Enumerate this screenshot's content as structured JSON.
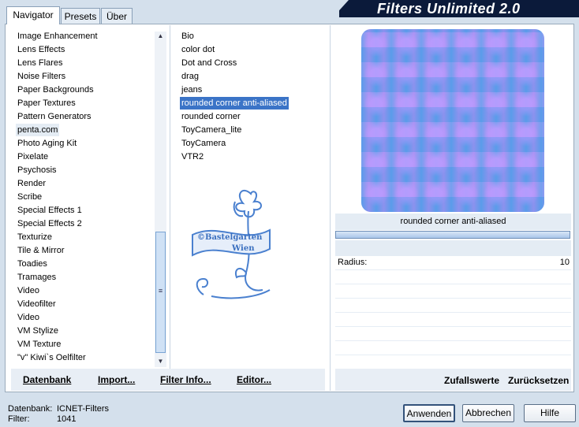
{
  "app": {
    "title": "Filters Unlimited 2.0"
  },
  "tabs": [
    {
      "label": "Navigator",
      "active": true
    },
    {
      "label": "Presets",
      "active": false
    },
    {
      "label": "Über",
      "active": false
    }
  ],
  "categories": [
    "Image Enhancement",
    "Lens Effects",
    "Lens Flares",
    "Noise Filters",
    "Paper Backgrounds",
    "Paper Textures",
    "Pattern Generators",
    "penta.com",
    "Photo Aging Kit",
    "Pixelate",
    "Psychosis",
    "Render",
    "Scribe",
    "Special Effects 1",
    "Special Effects 2",
    "Texturize",
    "Tile & Mirror",
    "Toadies",
    "Tramages",
    "Video",
    "Videofilter",
    "Video",
    "VM Stylize",
    "VM Texture",
    "\"v\" Kiwi`s Oelfilter"
  ],
  "selected_category": "penta.com",
  "filters": [
    "Bio",
    "color dot",
    "Dot and Cross",
    "drag",
    "jeans",
    "rounded corner anti-aliased",
    "rounded corner",
    "ToyCamera_lite",
    "ToyCamera",
    "VTR2"
  ],
  "selected_filter": "rounded corner anti-aliased",
  "watermark": {
    "line1": "©Bastelgarten",
    "line2": "Wien"
  },
  "bottom_links": {
    "database": "Datenbank",
    "import": "Import...",
    "filter_info": "Filter Info...",
    "editor": "Editor..."
  },
  "filter_panel": {
    "name": "rounded corner anti-aliased",
    "param_label": "Radius:",
    "param_value": "10",
    "randomize": "Zufallswerte",
    "reset": "Zurücksetzen"
  },
  "status": {
    "db_label": "Datenbank:",
    "db_value": "ICNET-Filters",
    "filter_label": "Filter:",
    "filter_value": "1041"
  },
  "buttons": {
    "apply": "Anwenden",
    "cancel": "Abbrechen",
    "help": "Hilfe"
  },
  "colors": {
    "selection": "#3b74c7",
    "background": "#d4e0ec",
    "banner": "#0b1a3a"
  }
}
